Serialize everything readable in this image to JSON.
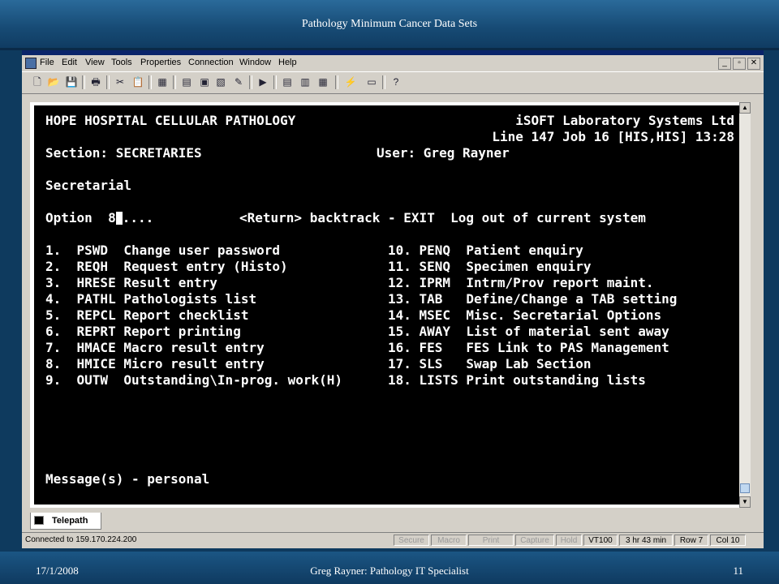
{
  "slide": {
    "title": "Pathology Minimum Cancer Data Sets",
    "footer_date": "17/1/2008",
    "footer_center": "Greg Rayner:  Pathology IT Specialist",
    "footer_page": "11"
  },
  "menu": [
    "File",
    "Edit",
    "View",
    "Tools",
    "Properties",
    "Connection",
    "Window",
    "Help"
  ],
  "mdi_controls": [
    "_",
    "▫",
    "✕"
  ],
  "toolbar_icons": [
    "new-icon",
    "open-icon",
    "save-icon",
    "print-icon",
    "cut-icon",
    "paste-icon",
    "properties-icon",
    "grid-icon",
    "font-icon",
    "capture-icon",
    "macro-icon",
    "play-icon",
    "doc-icon",
    "doc2-icon",
    "doc3-icon",
    "connect-icon",
    "screen-icon",
    "help-icon"
  ],
  "terminal": {
    "header_left": "HOPE HOSPITAL CELLULAR PATHOLOGY",
    "header_right": "iSOFT Laboratory Systems Ltd",
    "line_info": "Line 147 Job 16 [HIS,HIS] 13:28",
    "section": "Section: SECRETARIES",
    "user": "User: Greg Rayner",
    "heading": "Secretarial",
    "option_label": "Option  8",
    "option_after": "....",
    "return_hint": "<Return> backtrack - EXIT  Log out of current system",
    "left_col": [
      "1.  PSWD  Change user password",
      "2.  REQH  Request entry (Histo)",
      "3.  HRESE Result entry",
      "4.  PATHL Pathologists list",
      "5.  REPCL Report checklist",
      "6.  REPRT Report printing",
      "7.  HMACE Macro result entry",
      "8.  HMICE Micro result entry",
      "9.  OUTW  Outstanding\\In-prog. work(H)"
    ],
    "right_col": [
      "10. PENQ  Patient enquiry",
      "11. SENQ  Specimen enquiry",
      "12. IPRM  Intrm/Prov report maint.",
      "13. TAB   Define/Change a TAB setting",
      "14. MSEC  Misc. Secretarial Options",
      "15. AWAY  List of material sent away",
      "16. FES   FES Link to PAS Management",
      "17. SLS   Swap Lab Section",
      "18. LISTS Print outstanding lists"
    ],
    "messages": "Message(s) - personal"
  },
  "tab": {
    "label": "Telepath"
  },
  "status": {
    "connection": "Connected to 159.170.224.200",
    "cells": [
      "Secure",
      "Macro",
      "Print",
      "Capture",
      "Hold",
      "VT100",
      "3 hr 43 min",
      "Row 7",
      "Col 10"
    ]
  }
}
